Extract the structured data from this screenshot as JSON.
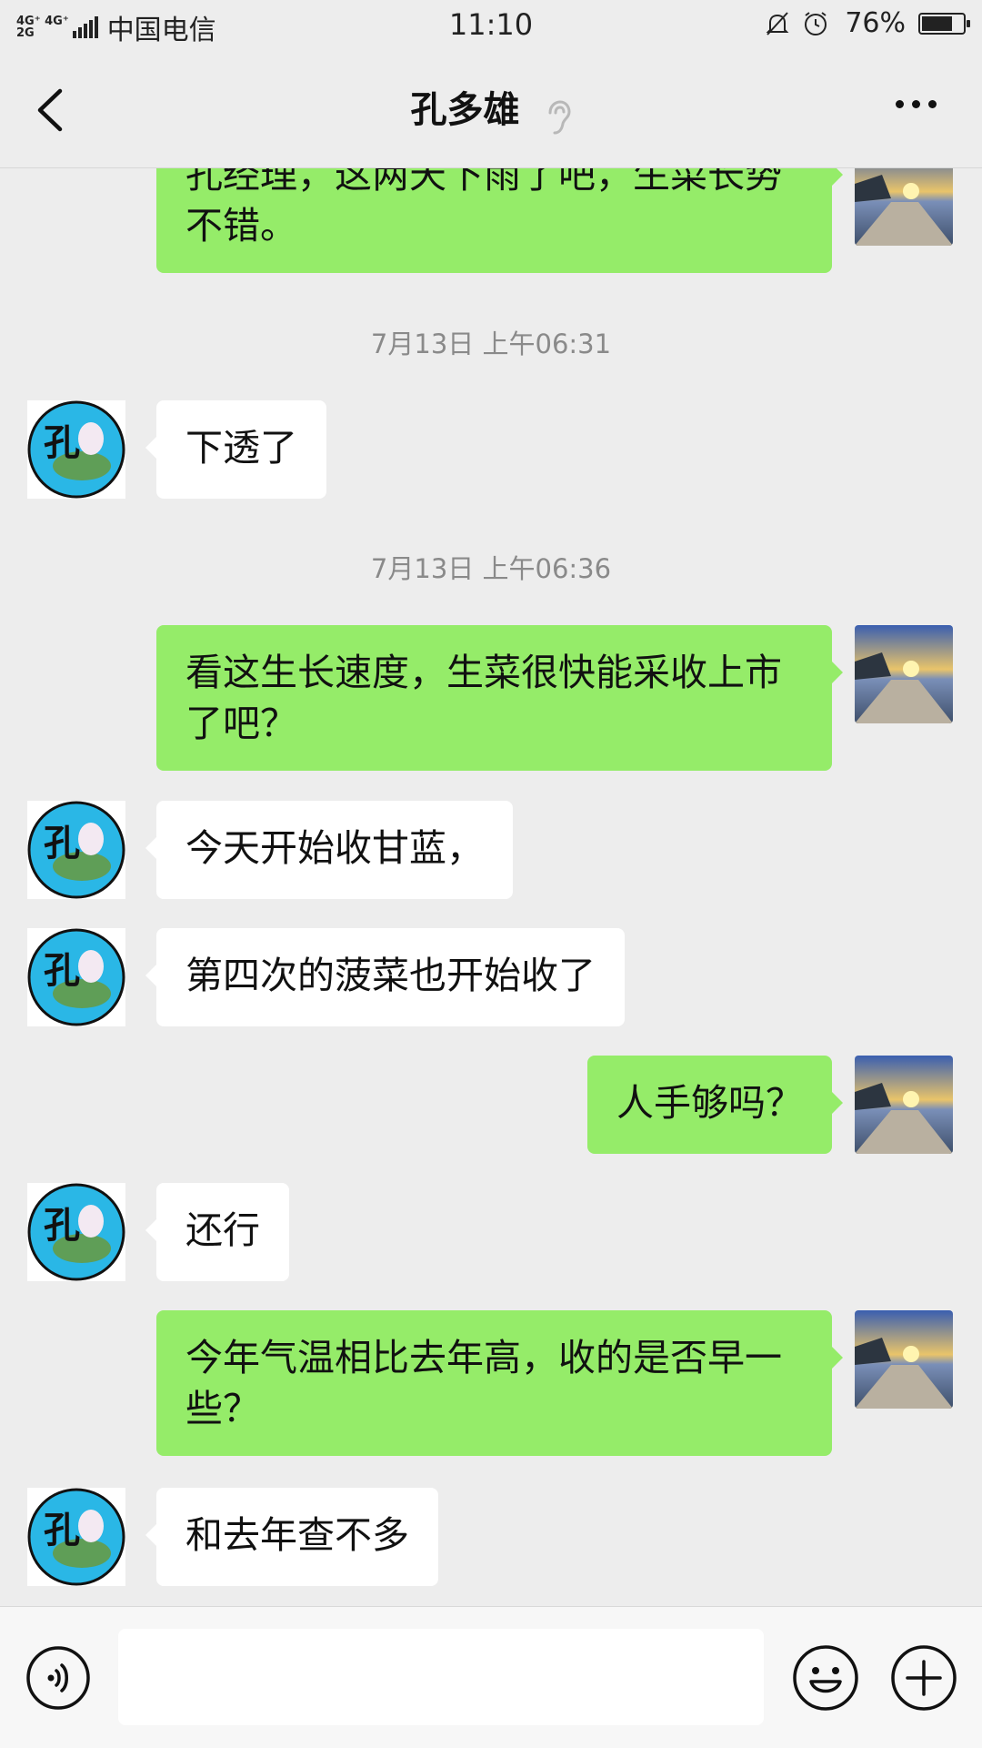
{
  "status_bar": {
    "network": "4G⁺ 4G⁺\n2G",
    "carrier": "中国电信",
    "time": "11:10",
    "battery_text": "76%",
    "battery_level": 0.76
  },
  "header": {
    "title": "孔多雄",
    "back_icon": "chevron-left-icon",
    "earpiece_icon": "ear-icon",
    "more_icon": "more-dots-icon"
  },
  "avatars": {
    "contact": "孔"
  },
  "messages": [
    {
      "kind": "out",
      "text": "孔经理，这两天下雨了吧，生菜长势不错。"
    },
    {
      "kind": "time",
      "text": "7月13日 上午06:31"
    },
    {
      "kind": "in",
      "text": "下透了"
    },
    {
      "kind": "time",
      "text": "7月13日 上午06:36"
    },
    {
      "kind": "out",
      "text": "看这生长速度，生菜很快能采收上市了吧？"
    },
    {
      "kind": "in",
      "text": "今天开始收甘蓝，"
    },
    {
      "kind": "in",
      "text": "第四次的菠菜也开始收了"
    },
    {
      "kind": "out",
      "text": "人手够吗？"
    },
    {
      "kind": "in",
      "text": "还行"
    },
    {
      "kind": "out",
      "text": "今年气温相比去年高，收的是否早一些？"
    },
    {
      "kind": "in",
      "text": "和去年查不多"
    }
  ],
  "input_bar": {
    "placeholder": "",
    "voice_icon": "voice-icon",
    "emoji_icon": "emoji-icon",
    "plus_icon": "plus-icon"
  },
  "colors": {
    "background": "#ededed",
    "outgoing_bubble": "#95ec69",
    "incoming_bubble": "#ffffff",
    "timestamp": "#8a8a8a"
  }
}
